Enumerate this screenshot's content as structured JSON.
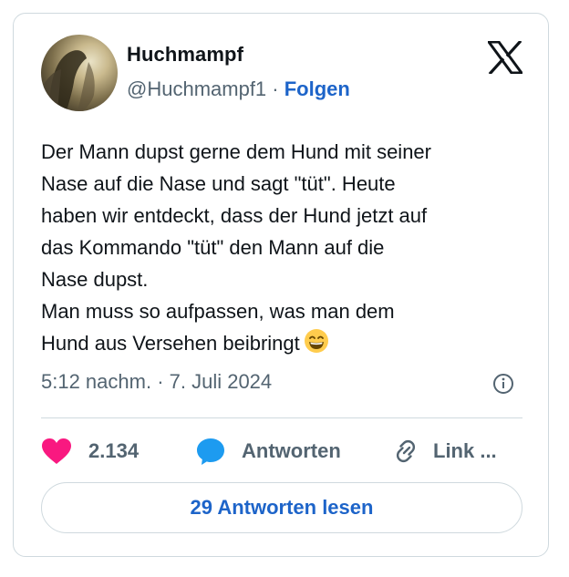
{
  "author": {
    "display_name": "Huchmampf",
    "handle": "@Huchmampf1",
    "separator": " · ",
    "follow_label": "Folgen"
  },
  "tweet": {
    "lines": [
      "Der Mann dupst gerne dem Hund mit seiner",
      "Nase auf die Nase und sagt \"tüt\". Heute",
      "haben wir entdeckt, dass der Hund jetzt auf",
      "das Kommando \"tüt\" den Mann auf die",
      "Nase dupst.",
      "Man muss so aufpassen, was man dem",
      "Hund aus Versehen beibringt"
    ],
    "emoji": "grinning-face-with-smiling-eyes"
  },
  "meta": {
    "timestamp": "5:12 nachm. · 7. Juli 2024"
  },
  "actions": {
    "likes": "2.134",
    "reply_label": "Antworten",
    "link_label": "Link ..."
  },
  "footer": {
    "read_replies_label": "29 Antworten lesen"
  },
  "colors": {
    "text": "#0f1419",
    "muted": "#536471",
    "link": "#1d64c9",
    "heart": "#f91880",
    "reply_bubble": "#1d9bf0",
    "border": "#cfd9de"
  }
}
